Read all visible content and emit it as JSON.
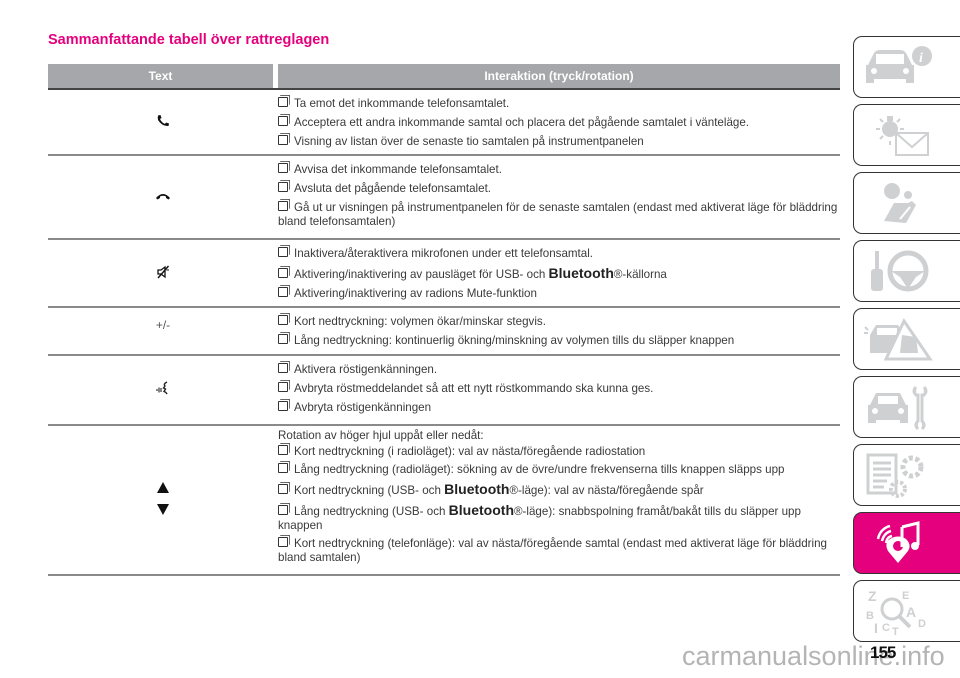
{
  "page": {
    "title": "Sammanfattande tabell över rattreglagen",
    "page_number": "155",
    "watermark": "carmanualsonline.info",
    "accent_color": "#e5007e"
  },
  "table": {
    "headers": [
      "Text",
      "Interaktion (tryck/rotation)"
    ],
    "rows": [
      {
        "control_icon": "phone-answer-icon",
        "control_text": "",
        "items": [
          "Ta emot det inkommande telefonsamtalet.",
          "Acceptera ett andra inkommande samtal och placera det pågående samtalet i vänteläge.",
          "Visning av listan över de senaste tio samtalen på instrumentpanelen"
        ]
      },
      {
        "control_icon": "phone-hangup-icon",
        "control_text": "",
        "items": [
          "Avvisa det inkommande telefonsamtalet.",
          "Avsluta det pågående telefonsamtalet.",
          "Gå ut ur visningen på instrumentpanelen för de senaste samtalen (endast med aktiverat läge för bläddring bland telefonsamtalen)"
        ]
      },
      {
        "control_icon": "mute-icon",
        "control_text": "",
        "items": [
          "Inaktivera/återaktivera mikrofonen under ett telefonsamtal.",
          {
            "pre": "Aktivering/inaktivering av pausläget för USB- och ",
            "brand": "Bluetooth",
            "post": "®-källorna"
          },
          "Aktivering/inaktivering av radions Mute-funktion"
        ]
      },
      {
        "control_icon": "",
        "control_text": "+/-",
        "items": [
          "Kort nedtryckning: volymen ökar/minskar stegvis.",
          "Lång nedtryckning: kontinuerlig ökning/minskning av volymen tills du släpper knappen"
        ]
      },
      {
        "control_icon": "voice-recognition-icon",
        "control_text": "",
        "items": [
          "Aktivera röstigenkänningen.",
          "Avbryta röstmeddelandet så att ett nytt röstkommando ska kunna ges.",
          "Avbryta röstigenkänningen"
        ]
      },
      {
        "control_icon": "up-down-arrows-icon",
        "control_text": "",
        "intro": "Rotation av höger hjul uppåt eller nedåt:",
        "items": [
          "Kort nedtryckning (i radioläget): val av nästa/föregående radiostation",
          "Lång nedtryckning (radioläget): sökning av de övre/undre frekvenserna tills knappen släpps upp",
          {
            "pre": "Kort nedtryckning (USB- och ",
            "brand": "Bluetooth",
            "post": "®-läge): val av nästa/föregående spår"
          },
          {
            "pre": "Lång nedtryckning (USB- och ",
            "brand": "Bluetooth",
            "post": "®-läge): snabbspolning framåt/bakåt tills du släpper upp knappen"
          },
          "Kort nedtryckning (telefonläge): val av nästa/föregående samtal (endast med aktiverat läge för bläddring bland samtalen)"
        ]
      }
    ]
  },
  "sidebar": {
    "tabs": [
      {
        "icon": "car-info-icon",
        "active": false
      },
      {
        "icon": "warning-light-message-icon",
        "active": false
      },
      {
        "icon": "airbag-seat-icon",
        "active": false
      },
      {
        "icon": "key-steering-wheel-icon",
        "active": false
      },
      {
        "icon": "car-breakdown-warning-icon",
        "active": false
      },
      {
        "icon": "car-maintenance-wrench-icon",
        "active": false
      },
      {
        "icon": "specifications-gears-icon",
        "active": false
      },
      {
        "icon": "multimedia-music-icon",
        "active": true
      },
      {
        "icon": "alphabetical-index-search-icon",
        "active": false
      }
    ]
  }
}
